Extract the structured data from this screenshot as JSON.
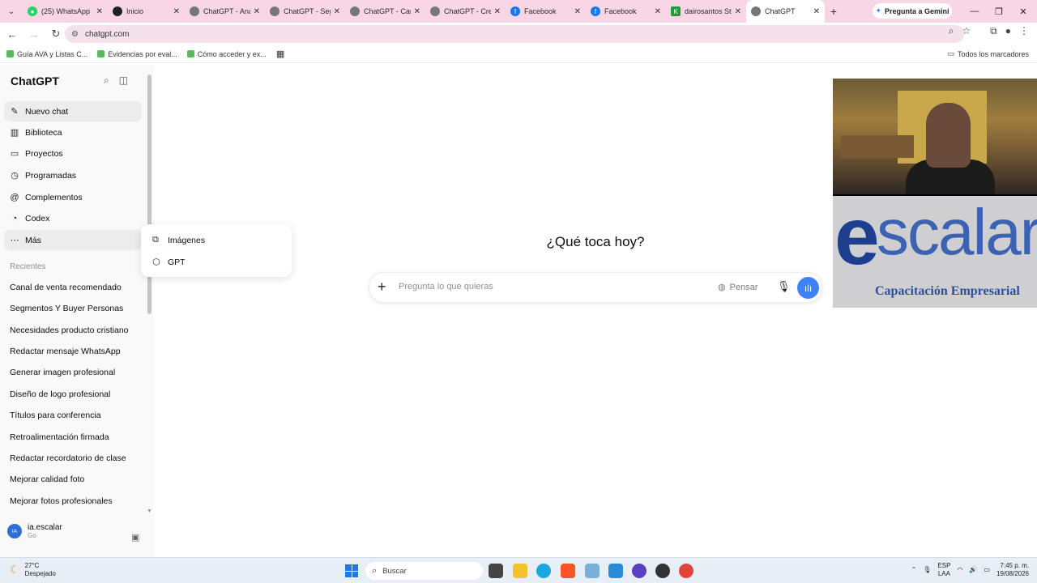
{
  "browser": {
    "tabs": [
      {
        "label": "(25) WhatsApp",
        "color": "#25d366"
      },
      {
        "label": "Inicio",
        "color": "#222222"
      },
      {
        "label": "ChatGPT - Ana",
        "color": "#555555"
      },
      {
        "label": "ChatGPT - Seg",
        "color": "#555555"
      },
      {
        "label": "ChatGPT - Can",
        "color": "#555555"
      },
      {
        "label": "ChatGPT - Cre",
        "color": "#555555"
      },
      {
        "label": "Facebook",
        "color": "#1877f2"
      },
      {
        "label": "Facebook",
        "color": "#1877f2"
      },
      {
        "label": "dairosantos St",
        "color": "#1e9e3a"
      },
      {
        "label": "ChatGPT",
        "color": "#555555"
      }
    ],
    "gemini_label": "Pregunta a Gemini",
    "url": "chatgpt.com",
    "bookmarks": [
      "Guía AVA y Listas C...",
      "Evidencias por eval...",
      "Cómo acceder y ex..."
    ],
    "all_bookmarks": "Todos los marcadores"
  },
  "sidebar": {
    "title": "ChatGPT",
    "nav": [
      {
        "label": "Nuevo chat",
        "icon": "edit-icon"
      },
      {
        "label": "Biblioteca",
        "icon": "library-icon"
      },
      {
        "label": "Proyectos",
        "icon": "folder-icon"
      },
      {
        "label": "Programadas",
        "icon": "clock-icon"
      },
      {
        "label": "Complementos",
        "icon": "at-icon"
      },
      {
        "label": "Codex",
        "icon": "codex-icon"
      },
      {
        "label": "Más",
        "icon": "more-icon"
      }
    ],
    "recent_title": "Recientes",
    "recents": [
      "Canal de venta recomendado",
      "Segmentos Y Buyer Personas",
      "Necesidades producto cristiano",
      "Redactar mensaje WhatsApp",
      "Generar imagen profesional",
      "Diseño de logo profesional",
      "Títulos para conferencia",
      "Retroalimentación firmada",
      "Redactar recordatorio de clase",
      "Mejorar calidad foto",
      "Mejorar fotos profesionales"
    ],
    "user": {
      "initials": "IA",
      "name": "ia.escalar",
      "plan": "Go"
    }
  },
  "popover": {
    "items": [
      {
        "label": "Imágenes",
        "icon": "images-icon"
      },
      {
        "label": "GPT",
        "icon": "cube-icon"
      }
    ]
  },
  "main": {
    "heading": "¿Qué toca hoy?",
    "prompt_placeholder": "Pregunta lo que quieras",
    "think_label": "Pensar"
  },
  "overlay": {
    "logo_e": "e",
    "logo_word": "scalar",
    "logo_sub": "Capacitación Empresarial"
  },
  "taskbar": {
    "temp": "27°C",
    "weather": "Despejado",
    "search": "Buscar",
    "lang1": "ESP",
    "lang2": "LAA",
    "time": "7:45 p. m.",
    "date": "19/08/2026"
  }
}
